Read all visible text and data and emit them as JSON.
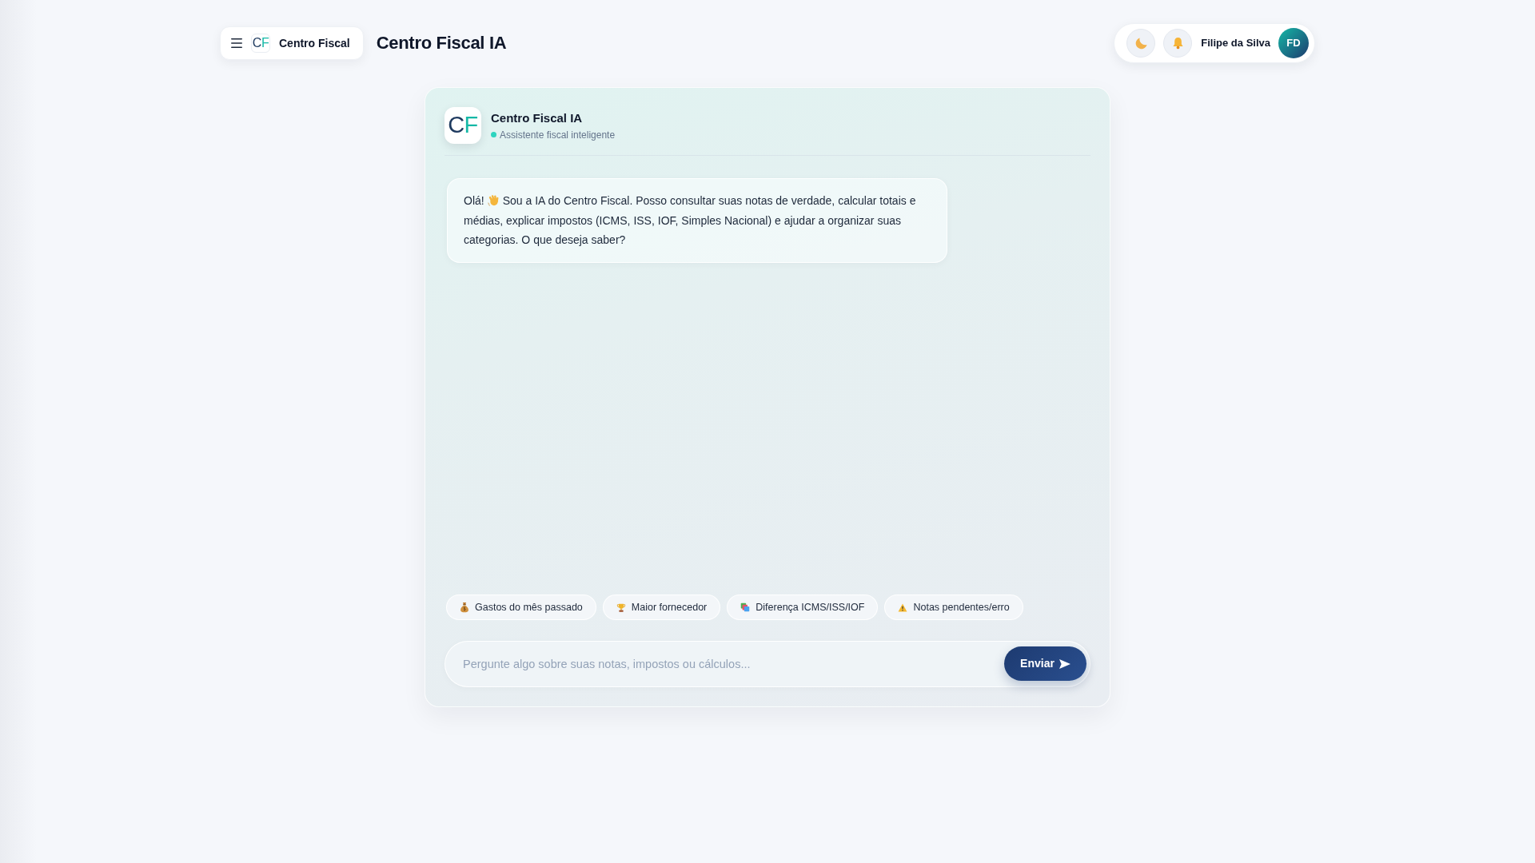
{
  "header": {
    "brand": {
      "logo": "CF",
      "name": "Centro Fiscal"
    },
    "title": "Centro Fiscal IA"
  },
  "user_menu": {
    "user_name": "Filipe da Silva",
    "initials": "FD"
  },
  "chat": {
    "logo": "CF",
    "title": "Centro Fiscal IA",
    "subtitle": "Assistente fiscal inteligente",
    "online": true,
    "messages": [
      {
        "greeting": "Olá!",
        "text": "Sou a IA do Centro Fiscal. Posso consultar suas notas de verdade, calcular totais e médias, explicar impostos (ICMS, ISS, IOF, Simples Nacional) e ajudar a organizar suas categorias. O que deseja saber?"
      }
    ],
    "suggestions": [
      {
        "kind": "expenses",
        "label": "Gastos do mês passado"
      },
      {
        "kind": "supplier",
        "label": "Maior fornecedor"
      },
      {
        "kind": "taxes",
        "label": "Diferença ICMS/ISS/IOF"
      },
      {
        "kind": "alerts",
        "label": "Notas pendentes/erro"
      }
    ],
    "composer": {
      "placeholder": "Pergunte algo sobre suas notas, impostos ou cálculos...",
      "send_label": "Enviar"
    }
  }
}
